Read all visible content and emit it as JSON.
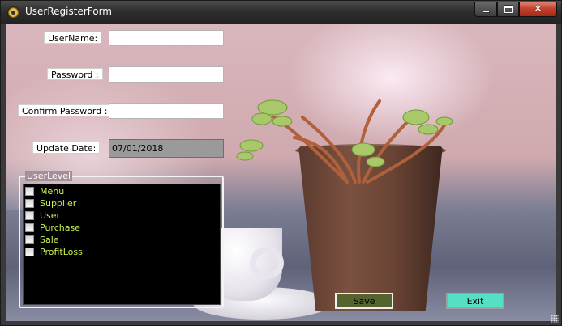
{
  "window": {
    "title": "UserRegisterForm",
    "controls": {
      "minimize": "",
      "maximize": "",
      "close": "✕"
    }
  },
  "form": {
    "username": {
      "label": "UserName:",
      "value": ""
    },
    "password": {
      "label": "Password :",
      "value": ""
    },
    "confirm_password": {
      "label": "Confirm Password :",
      "value": ""
    },
    "update_date": {
      "label": "Update Date:",
      "value": "07/01/2018"
    }
  },
  "user_level": {
    "title": "UserLevel",
    "items": [
      {
        "label": "Menu",
        "checked": false
      },
      {
        "label": "Supplier",
        "checked": false
      },
      {
        "label": "User",
        "checked": false
      },
      {
        "label": "Purchase",
        "checked": false
      },
      {
        "label": "Sale",
        "checked": false
      },
      {
        "label": "ProfitLoss",
        "checked": false
      }
    ]
  },
  "buttons": {
    "save": "Save",
    "exit": "Exit"
  },
  "colors": {
    "list_text": "#c8f050",
    "save_bg": "#55632e",
    "exit_bg": "#55e0c5",
    "close_button": "#c0402c"
  }
}
